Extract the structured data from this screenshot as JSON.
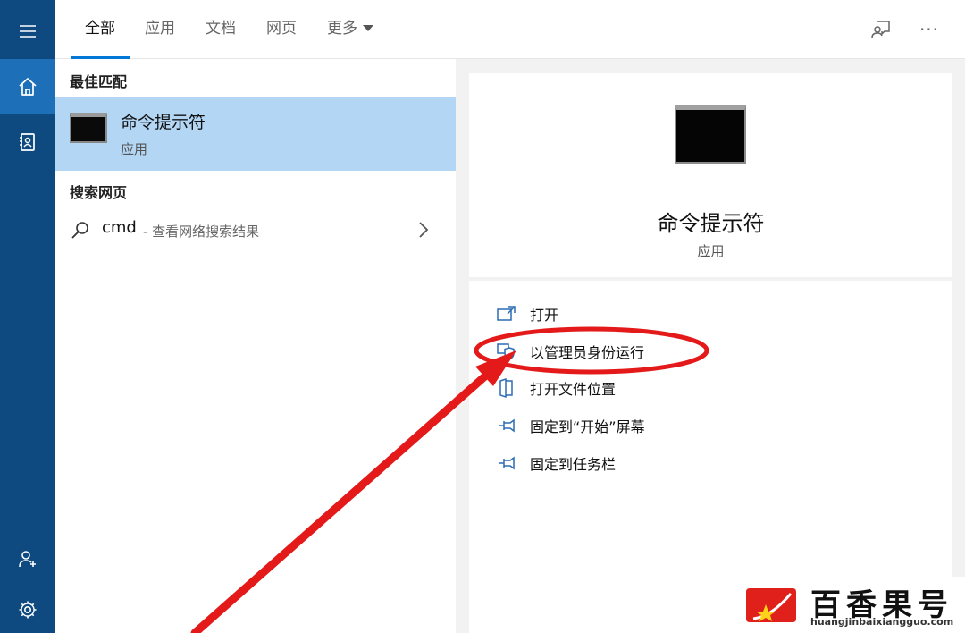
{
  "rail": {
    "items": [
      {
        "icon": "hamburger-menu-icon"
      },
      {
        "icon": "home-icon",
        "active": true
      },
      {
        "icon": "notebook-icon"
      },
      {
        "icon": "account-icon"
      },
      {
        "icon": "gear-icon"
      }
    ]
  },
  "tabs": [
    {
      "label": "全部",
      "active": true
    },
    {
      "label": "应用"
    },
    {
      "label": "文档"
    },
    {
      "label": "网页"
    },
    {
      "label": "更多"
    }
  ],
  "topbar": {
    "feedback_icon": "feedback-icon",
    "more_icon": "ellipsis-icon",
    "more_glyph": "···"
  },
  "results": {
    "best_match_title": "最佳匹配",
    "best_match": {
      "name": "命令提示符",
      "type": "应用"
    },
    "web_title": "搜索网页",
    "web_query": "cmd",
    "web_desc": "- 查看网络搜索结果"
  },
  "detail": {
    "name": "命令提示符",
    "type": "应用",
    "actions": [
      {
        "label": "打开",
        "icon": "open-icon"
      },
      {
        "label": "以管理员身份运行",
        "icon": "run-as-admin-shield-icon"
      },
      {
        "label": "打开文件位置",
        "icon": "file-location-icon"
      },
      {
        "label": "固定到“开始”屏幕",
        "icon": "pin-icon"
      },
      {
        "label": "固定到任务栏",
        "icon": "pin-icon"
      }
    ]
  },
  "colors": {
    "rail": "#0e4a80",
    "rail_active": "#1d6fb8",
    "selection": "#b3d6f5",
    "accent": "#0078d7",
    "annotation": "#e41a1a"
  },
  "watermark": {
    "title": "百香果号",
    "url": "huangjinbaixiangguo.com"
  }
}
